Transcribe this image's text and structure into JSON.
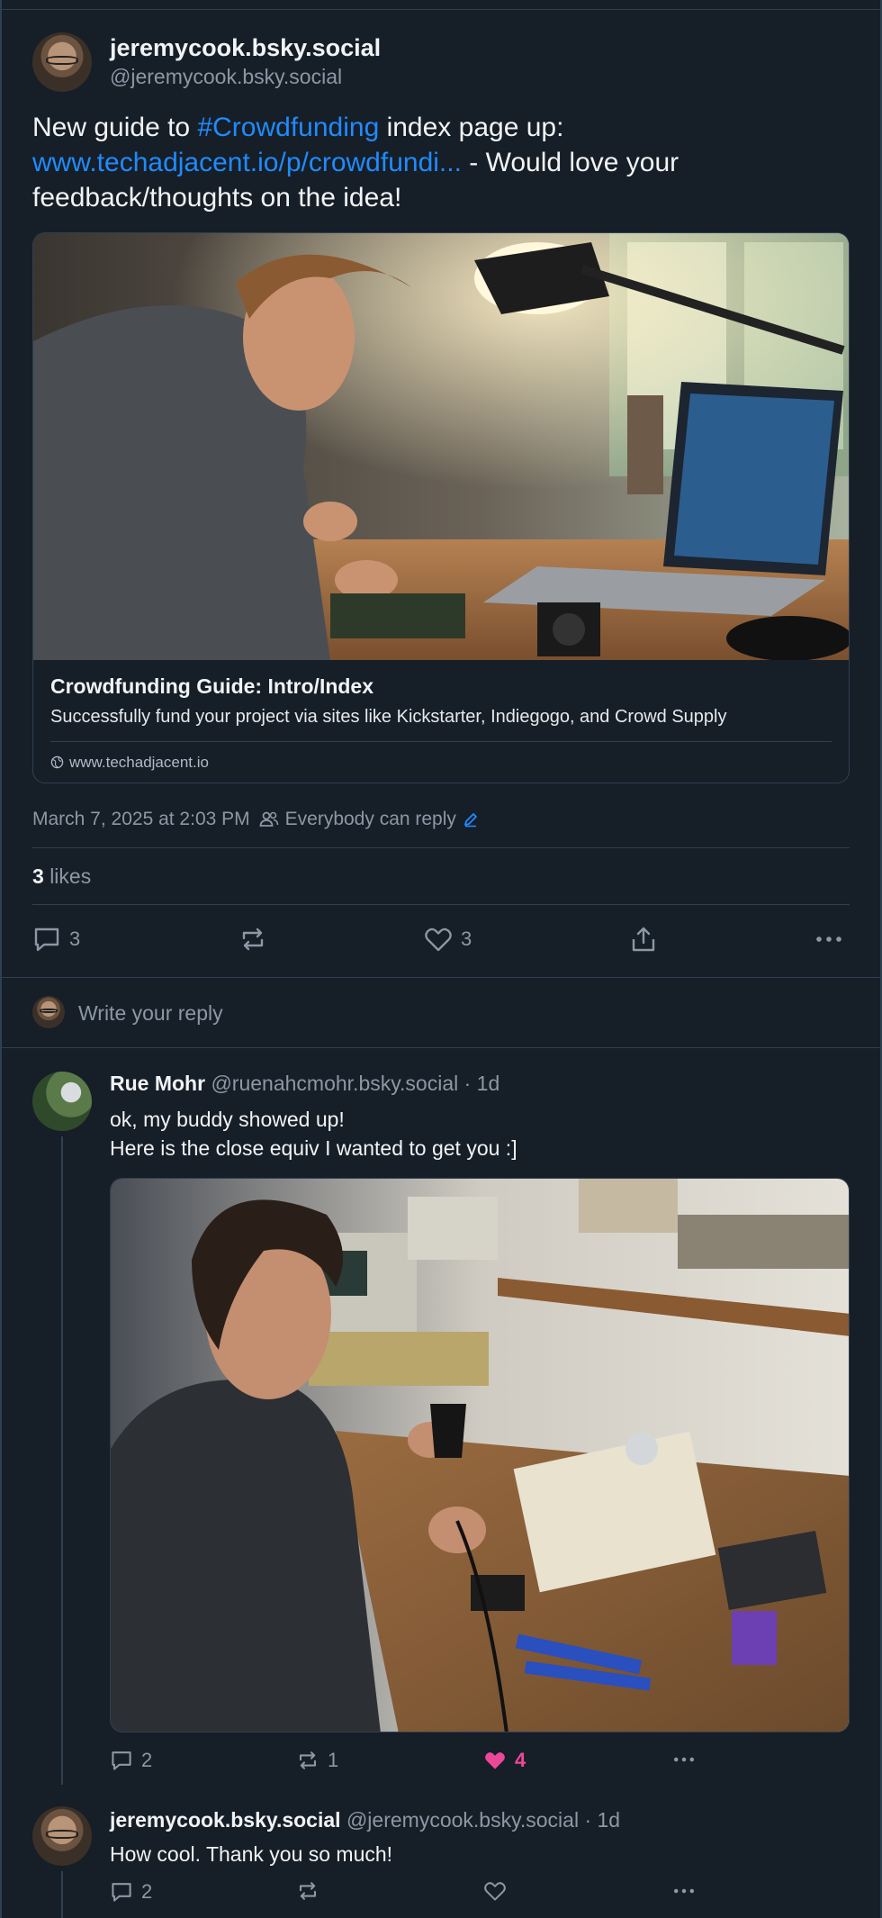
{
  "post": {
    "display_name": "jeremycook.bsky.social",
    "handle": "@jeremycook.bsky.social",
    "text_pre": "New guide to ",
    "hashtag": "#Crowdfunding",
    "text_mid": " index page up:",
    "link_text": "www.techadjacent.io/p/crowdfundi...",
    "text_post": " - Would love your feedback/thoughts on the idea!",
    "card": {
      "title": "Crowdfunding Guide: Intro/Index",
      "description": "Successfully fund your project via sites like Kickstarter, Indiegogo, and Crowd Supply",
      "domain": "www.techadjacent.io"
    },
    "timestamp": "March 7, 2025 at 2:03 PM",
    "reply_setting": "Everybody can reply",
    "likes_count": "3",
    "likes_label": "likes",
    "actions": {
      "replies": "3",
      "likes": "3"
    }
  },
  "reply_box": {
    "placeholder": "Write your reply"
  },
  "replies": [
    {
      "display_name": "Rue Mohr",
      "handle_time": "@ruenahcmohr.bsky.social · 1d",
      "line1": "ok, my buddy showed up!",
      "line2": "Here is the close equiv I wanted to get you :]",
      "actions": {
        "replies": "2",
        "reposts": "1",
        "likes": "4"
      }
    },
    {
      "display_name": "jeremycook.bsky.social",
      "handle_time": "@jeremycook.bsky.social · 1d",
      "line1": "How cool. Thank you so much!",
      "actions": {
        "replies": "2"
      }
    }
  ],
  "colors": {
    "background": "#161e27",
    "link": "#208bfe",
    "border": "#2e4052",
    "muted": "#8b98a5",
    "like": "#ec4899"
  }
}
